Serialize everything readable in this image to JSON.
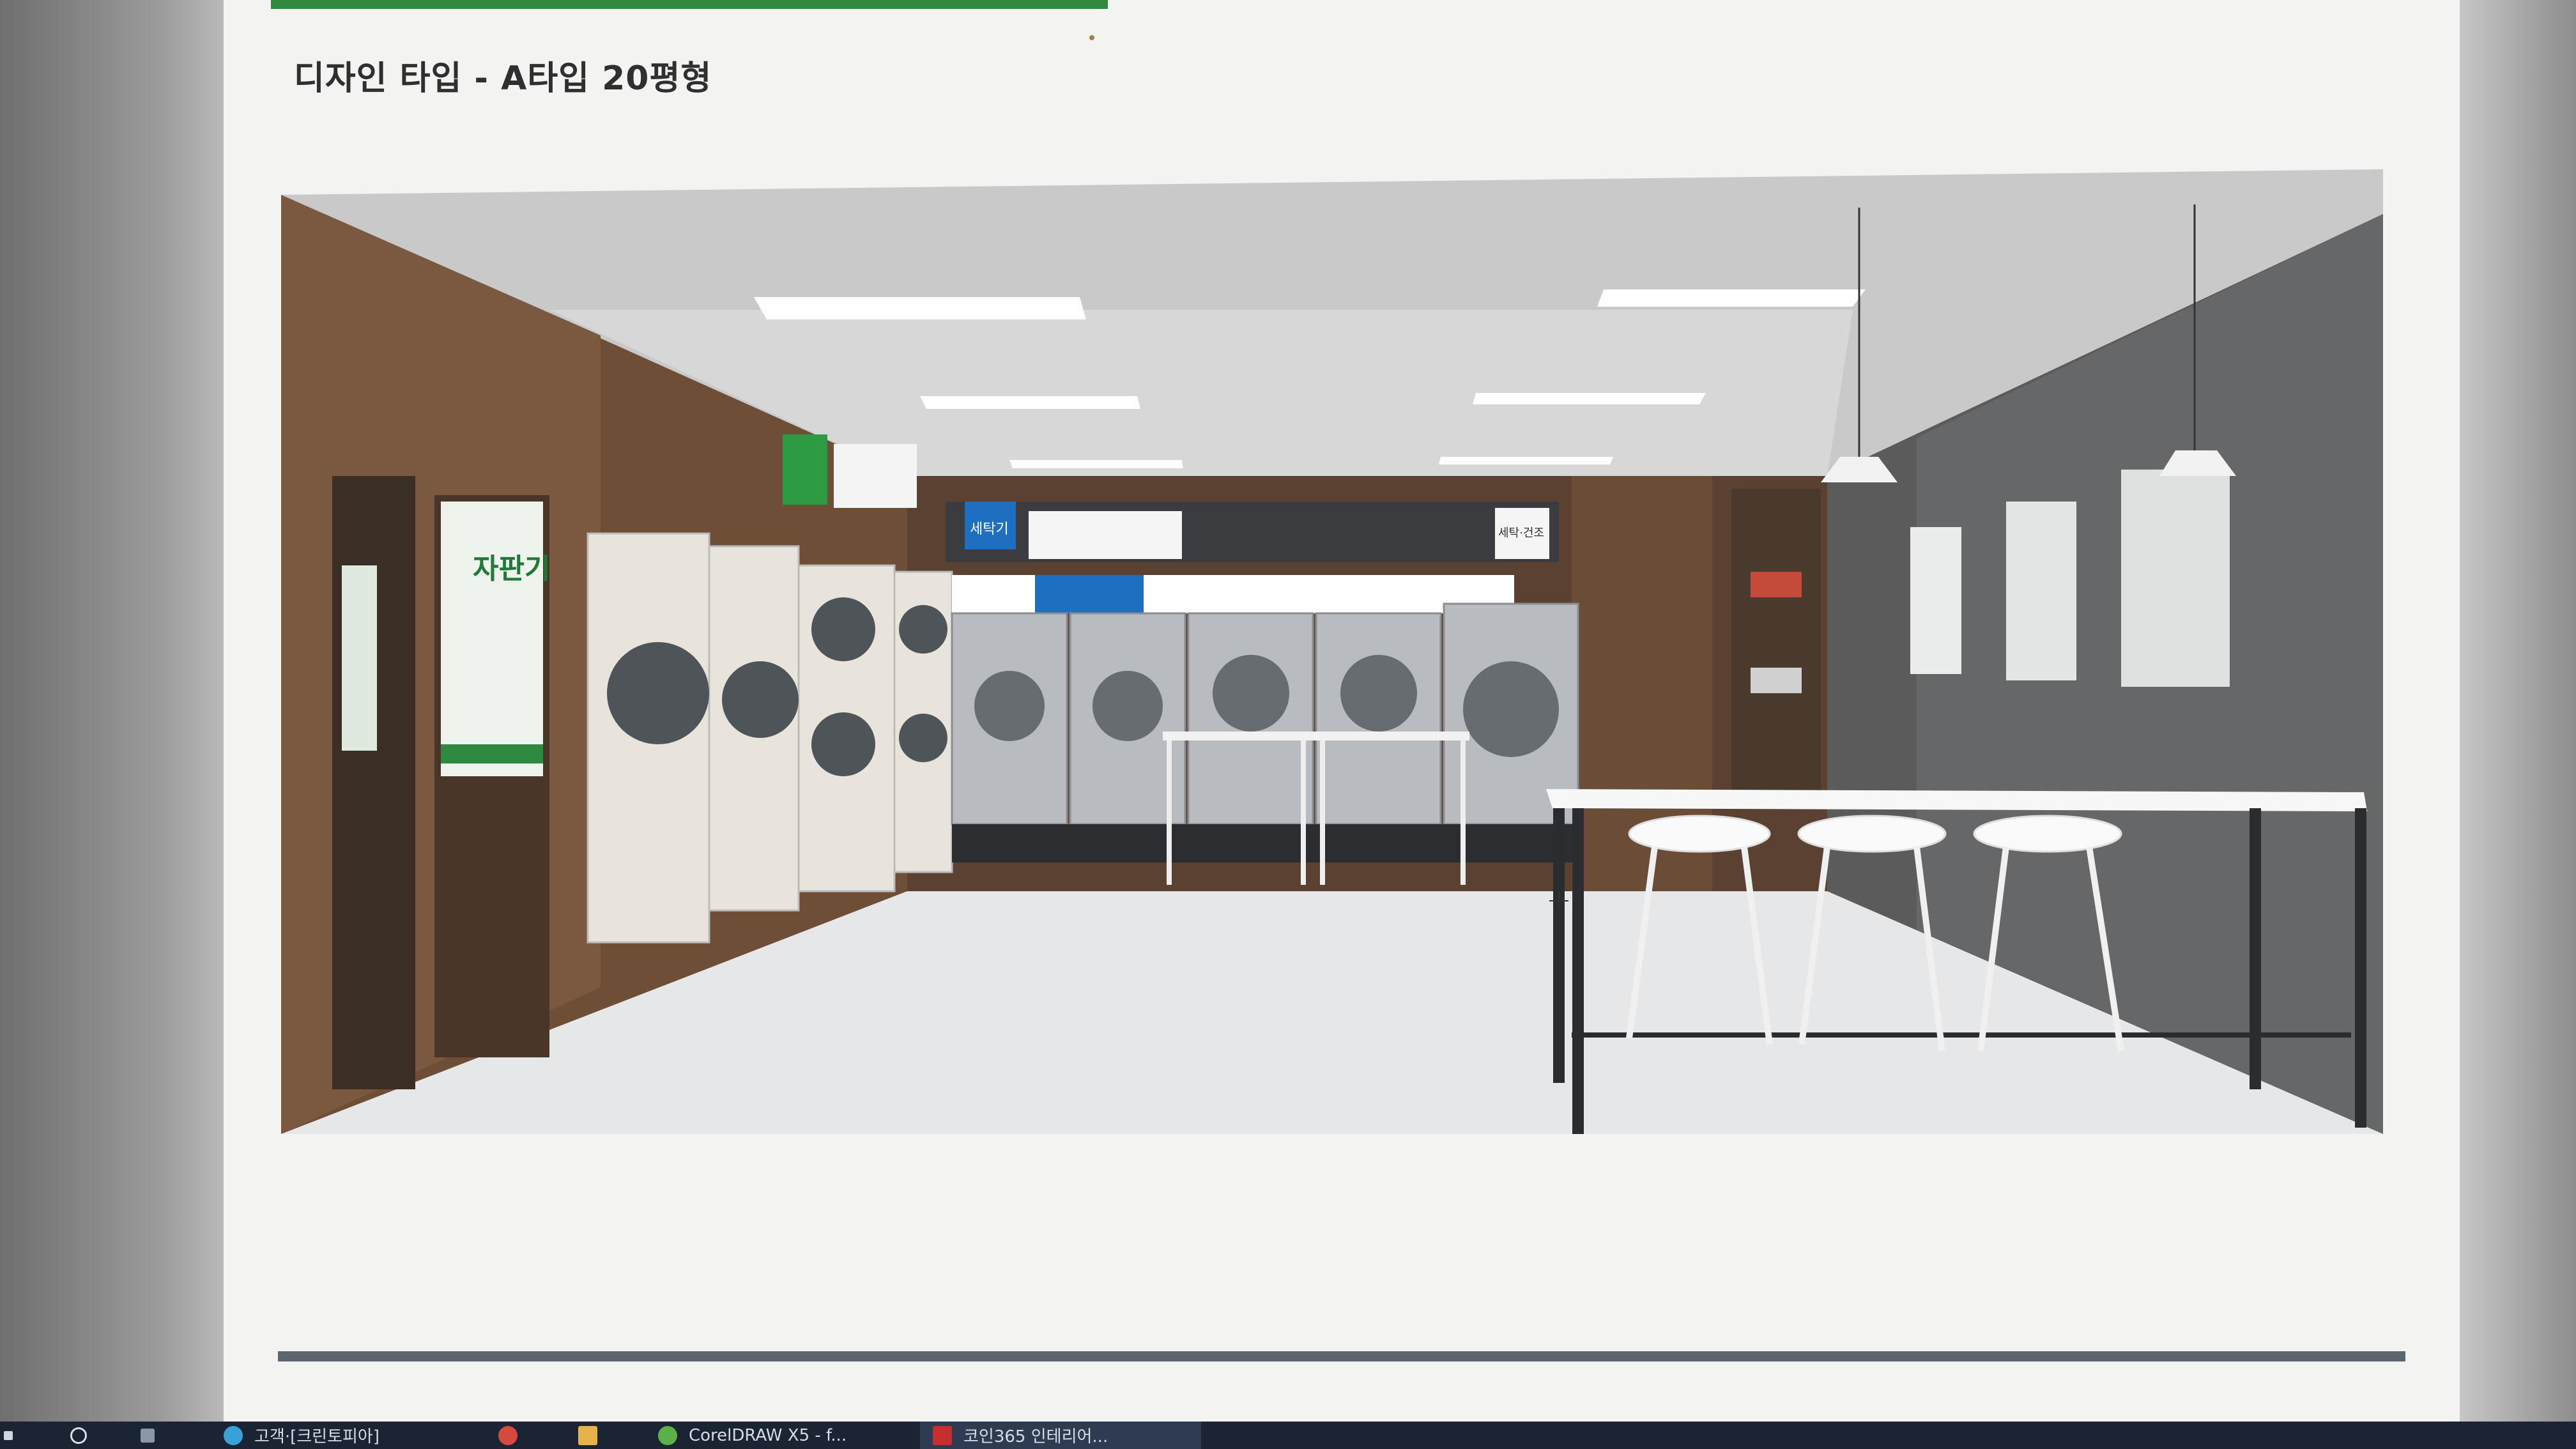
{
  "slide": {
    "title": "디자인 타입 - A타입 20평형"
  },
  "render_signs": {
    "vending_sign": "자판기",
    "washer_sign": "세탁기",
    "dryer_sign": "세탁·건조"
  },
  "taskbar": {
    "items": [
      {
        "label": "검색",
        "icon": "search-icon"
      },
      {
        "label": "보기",
        "icon": "task-view-icon"
      },
      {
        "label": "고객·[크린토피아]",
        "icon": "browser-icon"
      },
      {
        "label": "",
        "icon": "chrome-icon"
      },
      {
        "label": "",
        "icon": "folder-icon"
      },
      {
        "label": "CorelDRAW X5 - f...",
        "icon": "coreldraw-icon"
      },
      {
        "label": "코인365 인테리어...",
        "icon": "pdf-icon"
      }
    ]
  },
  "colors": {
    "accent_green": "#2d8a3e",
    "taskbar": "#1b2433",
    "slide_background": "#f3f3f1"
  }
}
